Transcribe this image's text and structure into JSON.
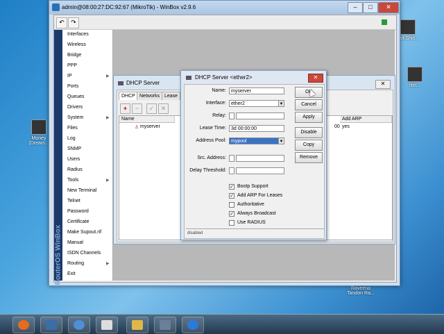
{
  "desktop": {
    "icons": [
      {
        "label": "Hot Shin..."
      },
      {
        "label": "Money (Dream..."
      },
      {
        "label": "rbn..."
      },
      {
        "label": "Raveena Tandon Ra..."
      }
    ]
  },
  "winbox": {
    "title": "admin@08:00:27:DC:92:67 (MikroTik) - WinBox v2.9.6",
    "brand": "RouterOS WinBox",
    "toolbar": {
      "undo": "↶",
      "redo": "↷"
    },
    "menu": [
      {
        "label": "Interfaces",
        "submenu": false
      },
      {
        "label": "Wireless",
        "submenu": false
      },
      {
        "label": "Bridge",
        "submenu": false
      },
      {
        "label": "PPP",
        "submenu": false
      },
      {
        "label": "IP",
        "submenu": true
      },
      {
        "label": "Ports",
        "submenu": false
      },
      {
        "label": "Queues",
        "submenu": false
      },
      {
        "label": "Drivers",
        "submenu": false
      },
      {
        "label": "System",
        "submenu": true
      },
      {
        "label": "Files",
        "submenu": false
      },
      {
        "label": "Log",
        "submenu": false
      },
      {
        "label": "SNMP",
        "submenu": false
      },
      {
        "label": "Users",
        "submenu": false
      },
      {
        "label": "Radius",
        "submenu": false
      },
      {
        "label": "Tools",
        "submenu": true
      },
      {
        "label": "New Terminal",
        "submenu": false
      },
      {
        "label": "Telnet",
        "submenu": false
      },
      {
        "label": "Password",
        "submenu": false
      },
      {
        "label": "Certificate",
        "submenu": false
      },
      {
        "label": "Make Supout.rif",
        "submenu": false
      },
      {
        "label": "Manual",
        "submenu": false
      },
      {
        "label": "ISDN Channels",
        "submenu": false
      },
      {
        "label": "Routing",
        "submenu": true
      },
      {
        "label": "Exit",
        "submenu": false
      }
    ]
  },
  "dhcp_list": {
    "title": "DHCP Server",
    "tabs": [
      "DHCP",
      "Networks",
      "Lease"
    ],
    "columns": {
      "name": "Name",
      "add_arp": "Add ARP"
    },
    "row": {
      "name": "myserver",
      "lease_tail": "00",
      "add_arp": "yes"
    }
  },
  "dialog": {
    "title": "DHCP Server <ether2>",
    "fields": {
      "name": {
        "label": "Name:",
        "value": "myserver"
      },
      "interface": {
        "label": "Interface:",
        "value": "ether2"
      },
      "relay": {
        "label": "Relay:",
        "value": ""
      },
      "lease_time": {
        "label": "Lease Time:",
        "value": "3d 00:00:00"
      },
      "address_pool": {
        "label": "Address Pool:",
        "value": "mypool"
      },
      "src_address": {
        "label": "Src. Address:",
        "value": ""
      },
      "delay_threshold": {
        "label": "Delay Threshold:",
        "value": ""
      }
    },
    "checkboxes": [
      {
        "label": "Bootp Support",
        "checked": true
      },
      {
        "label": "Add ARP For Leases",
        "checked": true
      },
      {
        "label": "Authoritative",
        "checked": false
      },
      {
        "label": "Always Broadcast",
        "checked": true
      },
      {
        "label": "Use RADIUS",
        "checked": false
      }
    ],
    "buttons": {
      "ok": "OK",
      "cancel": "Cancel",
      "apply": "Apply",
      "disable": "Disable",
      "copy": "Copy",
      "remove": "Remove"
    },
    "status": "disabled"
  },
  "taskbar": {
    "items": [
      "firefox",
      "computer",
      "chrome",
      "window",
      "explorer",
      "virtualbox",
      "teamviewer"
    ]
  },
  "colors": {
    "accent": "#1b3a6b",
    "selection": "#3a73c4",
    "close": "#c9483a"
  }
}
